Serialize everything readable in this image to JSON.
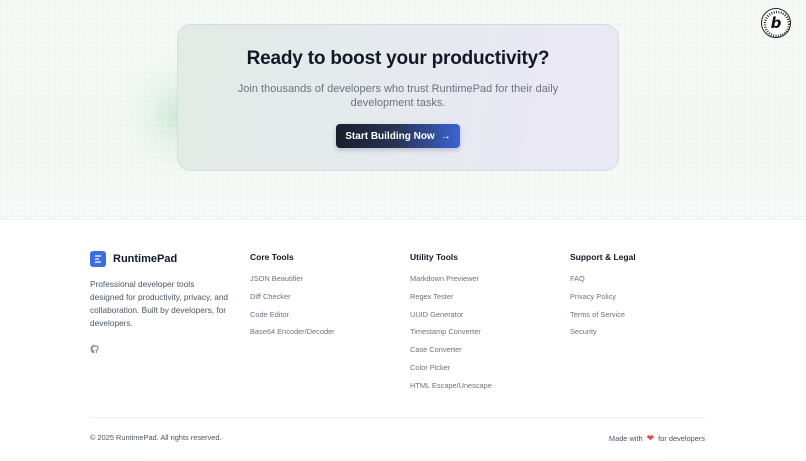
{
  "cta": {
    "title": "Ready to boost your productivity?",
    "subtitle": "Join thousands of developers who trust RuntimePad for their daily development tasks.",
    "button_label": "Start Building Now",
    "button_icon": "arrow-right-icon"
  },
  "badge": {
    "letter": "b"
  },
  "footer": {
    "brand": {
      "name": "RuntimePad",
      "description": "Professional developer tools designed for productivity, privacy, and collaboration. Built by developers, for developers.",
      "social_icon": "github-icon"
    },
    "columns": [
      {
        "title": "Core Tools",
        "links": [
          "JSON Beautifier",
          "Diff Checker",
          "Code Editor",
          "Base64 Encoder/Decoder"
        ]
      },
      {
        "title": "Utility Tools",
        "links": [
          "Markdown Previewer",
          "Regex Tester",
          "UUID Generator",
          "Timestamp Converter",
          "Case Converter",
          "Color Picker",
          "HTML Escape/Unescape"
        ]
      },
      {
        "title": "Support & Legal",
        "links": [
          "FAQ",
          "Privacy Policy",
          "Terms of Service",
          "Security"
        ]
      }
    ],
    "copyright": "© 2025 RuntimePad. All rights reserved.",
    "made_with_prefix": "Made with",
    "made_with_suffix": "for developers",
    "heart_color": "#e5484d"
  },
  "colors": {
    "accent": "#3b6fe0",
    "button_dark": "#1a1e2b"
  }
}
